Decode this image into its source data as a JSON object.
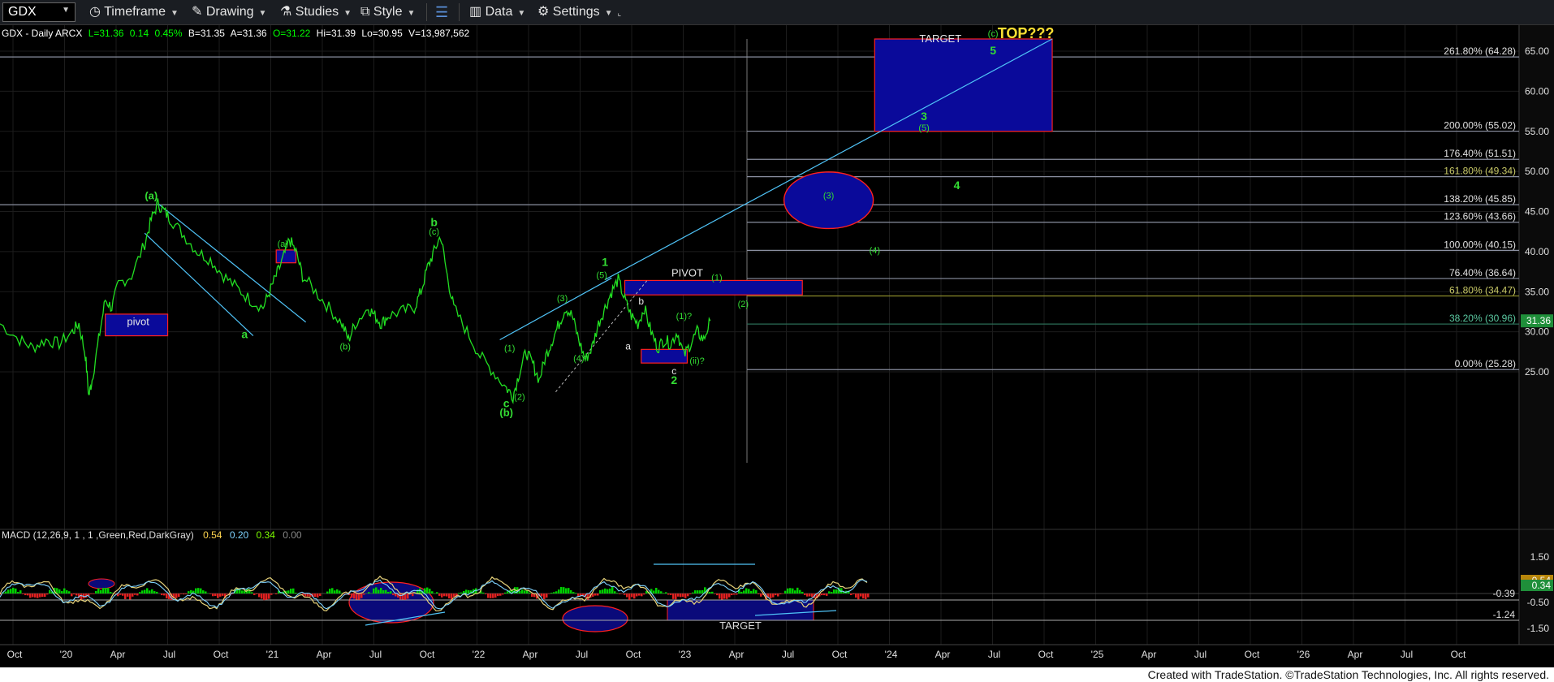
{
  "toolbar": {
    "symbol": "GDX",
    "timeframe": "Timeframe",
    "drawing": "Drawing",
    "studies": "Studies",
    "style": "Style",
    "data": "Data",
    "settings": "Settings"
  },
  "quote": {
    "name": "GDX - Daily  ARCX",
    "last": "L=31.36",
    "change": "0.14",
    "pct": "0.45%",
    "bid": "B=31.35",
    "ask": "A=31.36",
    "open": "O=31.22",
    "high": "Hi=31.39",
    "low": "Lo=30.95",
    "volume": "V=13,987,562"
  },
  "macd_header": {
    "label": "MACD (12,26,9, 1 , 1 ,Green,Red,DarkGray)",
    "v1": "0.54",
    "v2": "0.20",
    "v3": "0.34",
    "v4": "0.00"
  },
  "footer": "Created with TradeStation. ©TradeStation Technologies, Inc. All rights reserved.",
  "chart_data": {
    "type": "line",
    "title": "GDX - Daily",
    "price_axis": {
      "ylim": [
        20,
        67
      ],
      "ticks": [
        "65.00",
        "60.00",
        "55.00",
        "50.00",
        "45.00",
        "40.00",
        "35.00",
        "30.00",
        "25.00"
      ],
      "last_price_label": "31.36"
    },
    "macd_axis": {
      "ticks": [
        "1.50",
        "0.50",
        "-0.50",
        "-1.50"
      ],
      "levels": [
        "-0.39",
        "-1.24"
      ],
      "last_labels": [
        "0.54",
        "0.34"
      ]
    },
    "x_labels": [
      "Oct",
      "'20",
      "Apr",
      "Jul",
      "Oct",
      "'21",
      "Apr",
      "Jul",
      "Oct",
      "'22",
      "Apr",
      "Jul",
      "Oct",
      "'23",
      "Apr",
      "Jul",
      "Oct",
      "'24",
      "Apr",
      "Jul",
      "Oct",
      "'25",
      "Apr",
      "Jul",
      "Oct",
      "'26",
      "Apr",
      "Jul",
      "Oct"
    ],
    "price_series": {
      "name": "GDX",
      "points": [
        [
          0,
          31
        ],
        [
          3,
          29
        ],
        [
          5,
          28
        ],
        [
          7,
          29
        ],
        [
          9,
          28.5
        ],
        [
          11,
          30
        ],
        [
          12,
          31
        ],
        [
          13,
          27
        ],
        [
          13.5,
          22
        ],
        [
          14,
          24
        ],
        [
          15,
          29
        ],
        [
          16,
          34
        ],
        [
          17,
          33
        ],
        [
          18,
          36
        ],
        [
          20,
          37
        ],
        [
          22,
          41
        ],
        [
          23,
          44
        ],
        [
          24,
          46
        ],
        [
          25,
          45
        ],
        [
          26,
          44
        ],
        [
          28,
          42
        ],
        [
          30,
          40
        ],
        [
          32,
          39
        ],
        [
          34,
          37
        ],
        [
          36,
          35.5
        ],
        [
          38,
          34
        ],
        [
          40,
          33
        ],
        [
          41,
          35
        ],
        [
          42,
          37
        ],
        [
          43,
          39
        ],
        [
          44,
          41.5
        ],
        [
          45,
          40
        ],
        [
          46,
          37
        ],
        [
          48,
          35
        ],
        [
          50,
          33
        ],
        [
          52,
          31
        ],
        [
          53,
          29
        ],
        [
          54,
          31
        ],
        [
          56,
          33
        ],
        [
          57,
          32
        ],
        [
          58,
          31
        ],
        [
          59,
          32
        ],
        [
          61,
          32.5
        ],
        [
          63,
          33
        ],
        [
          64,
          35
        ],
        [
          65,
          38
        ],
        [
          66,
          40
        ],
        [
          67,
          42
        ],
        [
          68,
          37
        ],
        [
          69,
          33
        ],
        [
          71,
          30
        ],
        [
          73,
          27
        ],
        [
          75,
          25
        ],
        [
          77,
          23
        ],
        [
          78,
          22
        ],
        [
          79,
          25
        ],
        [
          80,
          27.5
        ],
        [
          81,
          26
        ],
        [
          82,
          24
        ],
        [
          83,
          27
        ],
        [
          84,
          29
        ],
        [
          85,
          31
        ],
        [
          86,
          33
        ],
        [
          87,
          32
        ],
        [
          88,
          29
        ],
        [
          89,
          26.5
        ],
        [
          90,
          28
        ],
        [
          91,
          31
        ],
        [
          92,
          33
        ],
        [
          93,
          35
        ],
        [
          94,
          36.5
        ],
        [
          95,
          34
        ],
        [
          96,
          32
        ],
        [
          97,
          31
        ],
        [
          98,
          33
        ],
        [
          99,
          30
        ],
        [
          100,
          28
        ],
        [
          101,
          29
        ],
        [
          102,
          28.5
        ],
        [
          103,
          30
        ],
        [
          104,
          27
        ],
        [
          105,
          28.5
        ],
        [
          106,
          30
        ],
        [
          107,
          29
        ],
        [
          108,
          31.36
        ]
      ]
    },
    "fib_levels": [
      {
        "label": "261.80% (64.28)",
        "price": 64.28
      },
      {
        "label": "200.00% (55.02)",
        "price": 55.02
      },
      {
        "label": "176.40% (51.51)",
        "price": 51.51
      },
      {
        "label": "161.80% (49.34)",
        "price": 49.34
      },
      {
        "label": "138.20% (45.85)",
        "price": 45.85
      },
      {
        "label": "123.60% (43.66)",
        "price": 43.66
      },
      {
        "label": "100.00% (40.15)",
        "price": 40.15
      },
      {
        "label": "76.40% (36.64)",
        "price": 36.64
      },
      {
        "label": "61.80% (34.47)",
        "price": 34.47
      },
      {
        "label": "38.20% (30.96)",
        "price": 30.96
      },
      {
        "label": "0.00% (25.28)",
        "price": 25.28
      }
    ],
    "boxes": [
      {
        "label": "TARGET",
        "x0": 133,
        "x1": 160,
        "y0": 55,
        "y1": 67.5
      },
      {
        "label": "PIVOT",
        "x0": 95,
        "x1": 122,
        "y0": 34.6,
        "y1": 36.4
      },
      {
        "label": "pivot",
        "x0": 16,
        "x1": 25.5,
        "y0": 29.5,
        "y1": 32.2
      },
      {
        "label": "",
        "x0": 97.5,
        "x1": 104.5,
        "y0": 26.1,
        "y1": 27.8
      },
      {
        "label": "",
        "x0": 42,
        "x1": 45,
        "y0": 38.6,
        "y1": 40.2
      }
    ],
    "annotations": [
      {
        "text": "TOP???",
        "x": 156,
        "y": 66.6
      },
      {
        "text": "(a)",
        "x": 23,
        "y": 46.5
      },
      {
        "text": "a",
        "x": 37.2,
        "y": 29.2
      },
      {
        "text": "(a)",
        "x": 43,
        "y": 40.6
      },
      {
        "text": "b",
        "x": 66,
        "y": 43.2
      },
      {
        "text": "(c)",
        "x": 66,
        "y": 42.1
      },
      {
        "text": "(b)",
        "x": 52.5,
        "y": 27.8
      },
      {
        "text": "c",
        "x": 77,
        "y": 20.6
      },
      {
        "text": "(b)",
        "x": 77,
        "y": 19.5
      },
      {
        "text": "(1)",
        "x": 77.5,
        "y": 27.6
      },
      {
        "text": "(2)",
        "x": 79,
        "y": 21.5
      },
      {
        "text": "(3)",
        "x": 85.5,
        "y": 33.8
      },
      {
        "text": "(4)",
        "x": 88,
        "y": 26.3
      },
      {
        "text": "(5)",
        "x": 91.5,
        "y": 36.7
      },
      {
        "text": "1",
        "x": 92,
        "y": 38.2
      },
      {
        "text": "a",
        "x": 95.5,
        "y": 27.8
      },
      {
        "text": "b",
        "x": 97.5,
        "y": 33.4
      },
      {
        "text": "(1)?",
        "x": 104,
        "y": 31.6
      },
      {
        "text": "(ii)?",
        "x": 106,
        "y": 26.0
      },
      {
        "text": "c",
        "x": 102.5,
        "y": 24.7
      },
      {
        "text": "2",
        "x": 102.5,
        "y": 23.5
      },
      {
        "text": "(1)",
        "x": 109,
        "y": 36.4
      },
      {
        "text": "(2)",
        "x": 113,
        "y": 33.1
      },
      {
        "text": "(3)",
        "x": 126,
        "y": 46.6
      },
      {
        "text": "(4)",
        "x": 133,
        "y": 39.8
      },
      {
        "text": "4",
        "x": 145.5,
        "y": 47.8
      },
      {
        "text": "3",
        "x": 140.5,
        "y": 56.4
      },
      {
        "text": "(5)",
        "x": 140.5,
        "y": 55.1
      },
      {
        "text": "5",
        "x": 151,
        "y": 64.6
      },
      {
        "text": "(c)",
        "x": 151,
        "y": 66.8
      },
      {
        "text": "PIVOT",
        "x": 104.5,
        "y": 36.9
      },
      {
        "text": "TARGET",
        "x": 143,
        "y": 66.1
      },
      {
        "text": "pivot",
        "x": 21,
        "y": 30.8
      }
    ],
    "trend_lines": [
      {
        "x0": 24,
        "y0": 46,
        "x1": 46.5,
        "y1": 31.2
      },
      {
        "x0": 22,
        "y0": 42.3,
        "x1": 38.5,
        "y1": 29.5
      },
      {
        "x0": 76,
        "y0": 29,
        "x1": 93,
        "y1": 36.7
      },
      {
        "x0": 92,
        "y0": 36.5,
        "x1": 160,
        "y1": 67.5
      },
      {
        "x0": 84.5,
        "y0": 22.5,
        "x1": 98.5,
        "y1": 36.5
      }
    ],
    "circle": {
      "x": 126,
      "y": 46.4,
      "rx": 5.5,
      "ry": 2.9
    }
  }
}
